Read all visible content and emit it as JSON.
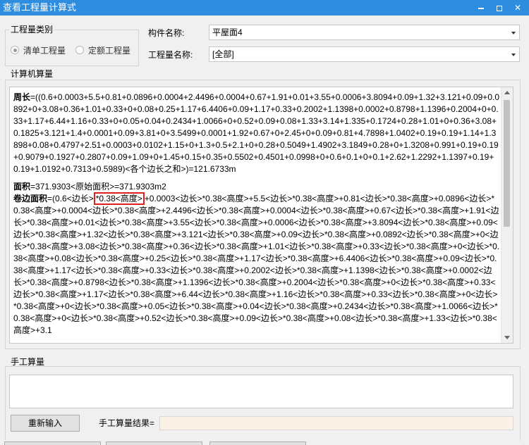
{
  "window": {
    "title": "查看工程量计算式",
    "minimize_icon": "minimize-icon",
    "maximize_icon": "maximize-icon",
    "close_icon": "close-icon"
  },
  "quantity_type": {
    "label": "工程量类别",
    "options": [
      {
        "label": "清单工程量",
        "checked": true
      },
      {
        "label": "定额工程量",
        "checked": false
      }
    ]
  },
  "component": {
    "label": "构件名称:",
    "value": "平屋面4"
  },
  "quantity_name": {
    "label": "工程量名称:",
    "value": "[全部]"
  },
  "computer_calc": {
    "label": "计算机算量",
    "perimeter_label": "周长",
    "perimeter_text": "=((0.6+0.0003+5.5+0.81+0.0896+0.0004+2.4496+0.0004+0.67+1.91+0.01+3.55+0.0006+3.8094+0.09+1.32+3.121+0.09+0.0892+0+3.08+0.36+1.01+0.33+0+0.08+0.25+1.17+6.4406+0.09+1.17+0.33+0.2002+1.1398+0.0002+0.8798+1.1396+0.2004+0+0.33+1.17+6.44+1.16+0.33+0+0.05+0.04+0.2434+1.0066+0+0.52+0.09+0.08+1.33+3.14+1.335+0.1724+0.28+1.01+0+0.36+3.08+0.1825+3.121+1.4+0.0001+0.09+3.81+0+3.5499+0.0001+1.92+0.67+0+2.45+0+0.09+0.81+4.7898+1.0402+0.19+0.19+1.14+1.3898+0.08+0.4797+2.51+0.0003+0.0102+1.15+0+1.3+0.5+2.1+0+0.28+0.5049+1.4902+3.1849+0.28+0+1.3208+0.991+0.19+0.19+0.9079+0.1927+0.2807+0.09+1.09+0+1.45+0.15+0.35+0.5502+0.4501+0.0998+0+0.6+0.1+0+0.1+2.62+1.2292+1.1397+0.19+0.19+1.0192+0.7313+0.5989)<各个边长之和>)=121.6733m",
    "area_label": "面积",
    "area_text": "=371.9303<原始面积>=371.9303m2",
    "roll_label": "卷边面积",
    "roll_prefix": "=(0.6<边长>",
    "roll_highlight": "*0.38<高度>",
    "roll_rest": "+0.0003<边长>*0.38<高度>+5.5<边长>*0.38<高度>+0.81<边长>*0.38<高度>+0.0896<边长>*0.38<高度>+0.0004<边长>*0.38<高度>+2.4496<边长>*0.38<高度>+0.0004<边长>*0.38<高度>+0.67<边长>*0.38<高度>+1.91<边长>*0.38<高度>+0.01<边长>*0.38<高度>+3.55<边长>*0.38<高度>+0.0006<边长>*0.38<高度>+3.8094<边长>*0.38<高度>+0.09<边长>*0.38<高度>+1.32<边长>*0.38<高度>+3.121<边长>*0.38<高度>+0.09<边长>*0.38<高度>+0.0892<边长>*0.38<高度>+0<边长>*0.38<高度>+3.08<边长>*0.38<高度>+0.36<边长>*0.38<高度>+1.01<边长>*0.38<高度>+0.33<边长>*0.38<高度>+0<边长>*0.38<高度>+0.08<边长>*0.38<高度>+0.25<边长>*0.38<高度>+1.17<边长>*0.38<高度>+6.4406<边长>*0.38<高度>+0.09<边长>*0.38<高度>+1.17<边长>*0.38<高度>+0.33<边长>*0.38<高度>+0.2002<边长>*0.38<高度>+1.1398<边长>*0.38<高度>+0.0002<边长>*0.38<高度>+0.8798<边长>*0.38<高度>+1.1396<边长>*0.38<高度>+0.2004<边长>*0.38<高度>+0<边长>*0.38<高度>+0.33<边长>*0.38<高度>+1.17<边长>*0.38<高度>+6.44<边长>*0.38<高度>+1.16<边长>*0.38<高度>+0.33<边长>*0.38<高度>+0<边长>*0.38<高度>+0<边长>*0.38<高度>+0.05<边长>*0.38<高度>+0.04<边长>*0.38<高度>+0.2434<边长>*0.38<高度>+1.0066<边长>*0.38<高度>+0<边长>*0.38<高度>+0.52<边长>*0.38<高度>+0.09<边长>*0.38<高度>+0.08<边长>*0.38<高度>+1.33<边长>*0.38<高度>+3.1"
  },
  "manual_calc": {
    "label": "手工算量",
    "reenter_button": "重新输入",
    "result_label": "手工算量结果="
  }
}
